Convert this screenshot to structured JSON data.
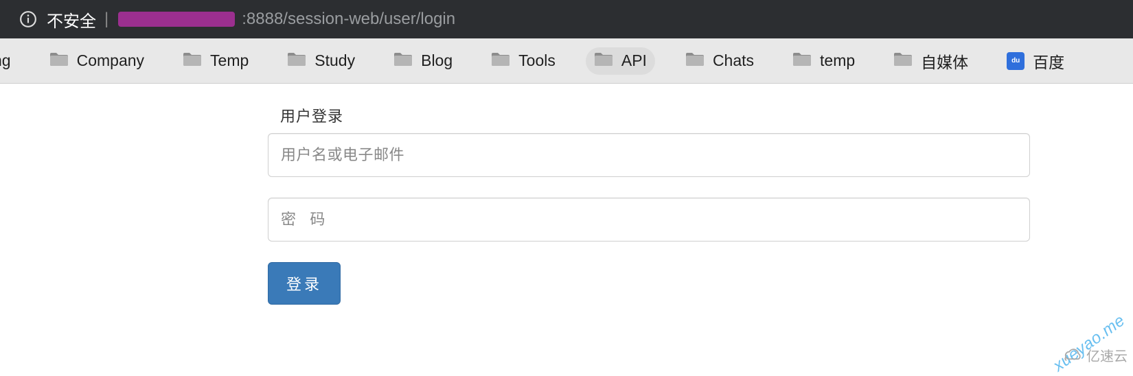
{
  "address": {
    "warning": "不安全",
    "port": ":8888",
    "path": "/session-web/user/login"
  },
  "bookmarks": {
    "partial_first": "ng",
    "items": [
      {
        "label": "Company",
        "active": false
      },
      {
        "label": "Temp",
        "active": false
      },
      {
        "label": "Study",
        "active": false
      },
      {
        "label": "Blog",
        "active": false
      },
      {
        "label": "Tools",
        "active": false
      },
      {
        "label": "API",
        "active": true
      },
      {
        "label": "Chats",
        "active": false
      },
      {
        "label": "temp",
        "active": false
      },
      {
        "label": "自媒体",
        "active": false
      }
    ],
    "baidu": {
      "label": "百度",
      "icon_text": "du"
    }
  },
  "login": {
    "title": "用户登录",
    "username_placeholder": "用户名或电子邮件",
    "password_placeholder": "密   码",
    "submit_label": "登录"
  },
  "watermarks": {
    "diagonal": "xueyao.me",
    "brand": "亿速云"
  }
}
